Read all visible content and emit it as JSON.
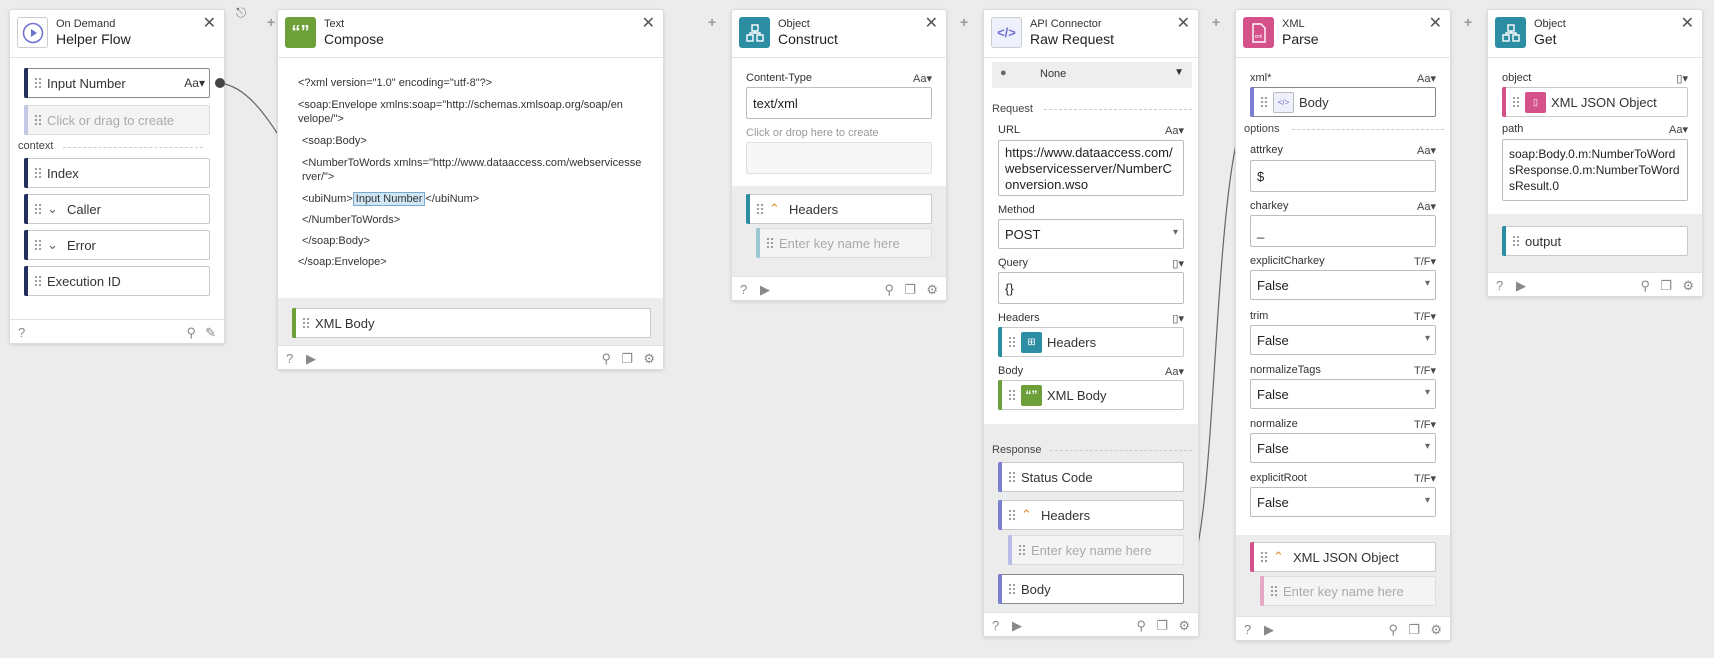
{
  "cards": {
    "helper": {
      "sub": "On Demand",
      "title": "Helper Flow",
      "input_number": "Input Number",
      "input_type": "Aa▾",
      "create_placeholder": "Click or drag to create",
      "context_label": "context",
      "items": [
        "Index",
        "Caller",
        "Error",
        "Execution ID"
      ]
    },
    "compose": {
      "sub": "Text",
      "title": "Compose",
      "lines": [
        "<?xml version=\"1.0\" encoding=\"utf-8\"?>",
        "<soap:Envelope xmlns:soap=\"http://schemas.xmlsoap.org/soap/envelope/\">",
        "<soap:Body>",
        "<NumberToWords xmlns=\"http://www.dataaccess.com/webservicesserver/\">",
        "<ubiNum>",
        "</ubiNum>",
        "</NumberToWords>",
        "</soap:Body>",
        "</soap:Envelope>"
      ],
      "token": "Input Number",
      "output": "XML Body"
    },
    "construct": {
      "sub": "Object",
      "title": "Construct",
      "content_type_label": "Content-Type",
      "content_type_type": "Aa▾",
      "content_type_value": "text/xml",
      "drop_hint": "Click or drop here to create",
      "headers": "Headers",
      "key_placeholder": "Enter key name here"
    },
    "raw": {
      "sub": "API Connector",
      "title": "Raw Request",
      "auth": "None",
      "request_label": "Request",
      "url_label": "URL",
      "url_type": "Aa▾",
      "url_value": "https://www.dataaccess.com/webservicesserver/NumberConversion.wso",
      "method_label": "Method",
      "method_value": "POST",
      "query_label": "Query",
      "query_value": "{}",
      "headers_label": "Headers",
      "headers_value": "Headers",
      "body_label": "Body",
      "body_type": "Aa▾",
      "body_value": "XML Body",
      "response_label": "Response",
      "status_code": "Status Code",
      "resp_headers": "Headers",
      "key_placeholder": "Enter key name here",
      "resp_body": "Body"
    },
    "parse": {
      "sub": "XML",
      "title": "Parse",
      "xml_label": "xml*",
      "xml_type": "Aa▾",
      "xml_value": "Body",
      "options_label": "options",
      "attrkey_label": "attrkey",
      "attrkey_type": "Aa▾",
      "attrkey_value": "$",
      "charkey_label": "charkey",
      "charkey_type": "Aa▾",
      "charkey_value": "_",
      "bools": [
        {
          "label": "explicitCharkey",
          "type": "T/F▾",
          "value": "False"
        },
        {
          "label": "trim",
          "type": "T/F▾",
          "value": "False"
        },
        {
          "label": "normalizeTags",
          "type": "T/F▾",
          "value": "False"
        },
        {
          "label": "normalize",
          "type": "T/F▾",
          "value": "False"
        },
        {
          "label": "explicitRoot",
          "type": "T/F▾",
          "value": "False"
        }
      ],
      "output": "XML JSON Object",
      "key_placeholder": "Enter key name here"
    },
    "get": {
      "sub": "Object",
      "title": "Get",
      "object_label": "object",
      "object_value": "XML JSON Object",
      "path_label": "path",
      "path_type": "Aa▾",
      "path_value": "soap:Body.0.m:NumberToWordsResponse.0.m:NumberToWordsResult.0",
      "output": "output"
    }
  },
  "colors": {
    "purple": "#6f6fd0",
    "green": "#6ea03a",
    "teal": "#2d8ea3",
    "pink": "#d4518a",
    "navy": "#23305e"
  }
}
